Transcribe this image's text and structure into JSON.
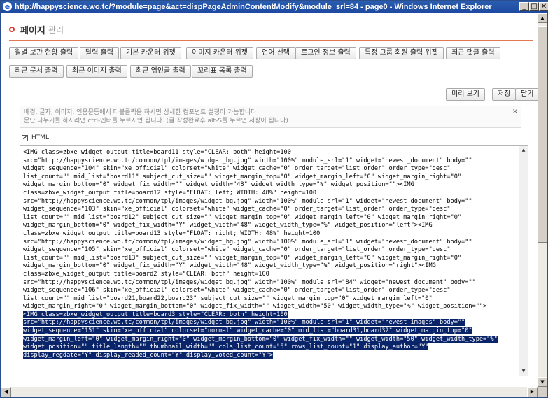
{
  "window": {
    "title": "http://happyscience.wo.tc/?module=page&act=dispPageAdminContentModify&module_srl=84 - page0 - Windows Internet Explorer",
    "minimize": "_",
    "maximize": "□",
    "close": "✕"
  },
  "page": {
    "title_main": "페이지",
    "title_sub": "관리"
  },
  "widget_buttons_row1": [
    "월별 보관 현황 출력",
    "달력 출력",
    "기본 카운터 위젯",
    "이미지 카운터 위젯",
    "언어 선택",
    "로그인 정보 출력",
    "특정 그룹 회원 출력 위젯",
    "최근 댓글 출력"
  ],
  "widget_buttons_row2": [
    "최근 문서 출력",
    "최근 이미지 출력",
    "최근 엮인글 출력",
    "꼬리표 목록 출력"
  ],
  "actions": {
    "preview": "미리 보기",
    "save": "저장",
    "close": "닫기"
  },
  "hint": {
    "line1": "배경, 글자, 이미지, 인용문등에서 더블클릭을 하시면 상세한 컴포넌트 설정이 가능합니다",
    "line2": "문단 나누기를 하시려면 ctrl-엔터를 누르시면 됩니다. (글 작성완료후 alt-S를 누르면 저장이 됩니다)",
    "close": "×"
  },
  "html_toggle": {
    "label": "HTML",
    "checked": true
  },
  "editor": {
    "lines": [
      "<IMG class=zbxe_widget_output title=board11 style=\"CLEAR: both\" height=100",
      "src=\"http://happyscience.wo.tc/common/tpl/images/widget_bg.jpg\" width=\"100%\" module_srl=\"1\" widget=\"newest_document\" body=\"\"",
      "widget_sequence=\"104\" skin=\"xe_official\" colorset=\"white\" widget_cache=\"0\" order_target=\"list_order\" order_type=\"desc\"",
      "list_count=\"\" mid_list=\"board11\" subject_cut_size=\"\" widget_margin_top=\"0\" widget_margin_left=\"0\" widget_margin_right=\"0\"",
      "widget_margin_bottom=\"0\" widget_fix_width=\"\" widget_width=\"48\" widget_width_type=\"%\" widget_position=\"\"><IMG",
      "class=zbxe_widget_output title=board12 style=\"FLOAT: left; WIDTH: 48%\" height=100",
      "src=\"http://happyscience.wo.tc/common/tpl/images/widget_bg.jpg\" width=\"100%\" module_srl=\"1\" widget=\"newest_document\" body=\"\"",
      "widget_sequence=\"103\" skin=\"xe_official\" colorset=\"white\" widget_cache=\"0\" order_target=\"list_order\" order_type=\"desc\"",
      "list_count=\"\" mid_list=\"board12\" subject_cut_size=\"\" widget_margin_top=\"0\" widget_margin_left=\"0\" widget_margin_right=\"0\"",
      "widget_margin_bottom=\"0\" widget_fix_width=\"Y\" widget_width=\"48\" widget_width_type=\"%\" widget_position=\"left\"><IMG",
      "class=zbxe_widget_output title=board13 style=\"FLOAT: right; WIDTH: 48%\" height=100",
      "src=\"http://happyscience.wo.tc/common/tpl/images/widget_bg.jpg\" width=\"100%\" module_srl=\"1\" widget=\"newest_document\" body=\"\"",
      "widget_sequence=\"105\" skin=\"xe_official\" colorset=\"white\" widget_cache=\"0\" order_target=\"list_order\" order_type=\"desc\"",
      "list_count=\"\" mid_list=\"board13\" subject_cut_size=\"\" widget_margin_top=\"0\" widget_margin_left=\"0\" widget_margin_right=\"0\"",
      "widget_margin_bottom=\"0\" widget_fix_width=\"Y\" widget_width=\"48\" widget_width_type=\"%\" widget_position=\"right\"><IMG",
      "class=zbxe_widget_output title=board2 style=\"CLEAR: both\" height=100",
      "src=\"http://happyscience.wo.tc/common/tpl/images/widget_bg.jpg\" width=\"100%\" module_srl=\"84\" widget=\"newest_document\" body=\"\"",
      "widget_sequence=\"106\" skin=\"xe_official\" colorset=\"white\" widget_cache=\"0\" order_target=\"list_order\" order_type=\"desc\"",
      "list_count=\"\" mid_list=\"board21,board22,board23\" subject_cut_size=\"\" widget_margin_top=\"0\" widget_margin_left=\"0\"",
      "widget_margin_right=\"0\" widget_margin_bottom=\"0\" widget_fix_width=\"\" widget_width=\"50\" widget_width_type=\"%\" widget_position=\"\">"
    ],
    "selected_lines": [
      "<IMG class=zbxe_widget_output title=board3 style=\"CLEAR: both\" height=100",
      "src=\"http://happyscience.wo.tc/common/tpl/images/widget_bg.jpg\" width=\"100%\" module_srl=\"1\" widget=\"newest_images\" body=\"\"",
      "widget_sequence=\"151\" skin=\"xe_official\" colorset=\"normal\" widget_cache=\"0\" mid_list=\"board31,board32\" widget_margin_top=\"0\"",
      "widget_margin_left=\"0\" widget_margin_right=\"0\" widget_margin_bottom=\"0\" widget_fix_width=\"\" widget_width=\"50\" widget_width_type=\"%\"",
      "widget_position=\"\" title_length=\"\" thumbnail_width=\"\" cols_list_count=\"5\" rows_list_count=\"1\" display_author=\"Y\"",
      "display_regdate=\"Y\" display_readed_count=\"Y\" display_voted_count=\"Y\">"
    ]
  }
}
